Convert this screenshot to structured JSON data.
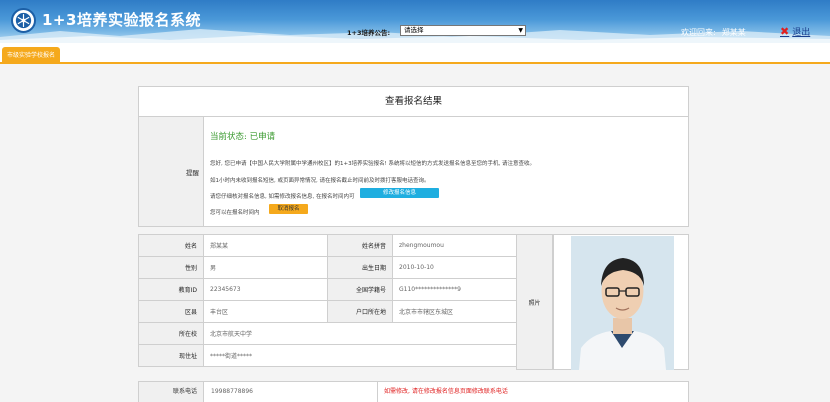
{
  "header": {
    "title": "1+3培养实验报名系统",
    "notice_label": "1+3培养公告:",
    "notice_select_value": "请选择",
    "welcome_label": "欢迎回来:",
    "user_name": "郑某某",
    "logout_label": "退出"
  },
  "tabs": [
    {
      "label": "市级实验学校报名"
    }
  ],
  "result": {
    "title": "查看报名结果",
    "remind_label": "提醒",
    "status": "当前状态: 已申请",
    "line1": "您好, 您已申请【中国人民大学附属中学通州校区】的1+3培养实验报名! 系统将以短信的方式发送报名信息至您的手机, 请注意查收。",
    "line2": "如1小时内未收到报名短信, 或页面异常情况, 请在报名截止时间前及时拨打客服电话查询。",
    "line3": "请您仔细核对报名信息, 如需修改报名信息, 在报名时间内可",
    "edit_button": "修改报名信息",
    "line4": "您可以在报名时间内",
    "cancel_button": "取消报名"
  },
  "info": {
    "name_label": "姓名",
    "name_value": "郑某某",
    "pinyin_label": "姓名拼音",
    "pinyin_value": "zhengmoumou",
    "gender_label": "性别",
    "gender_value": "男",
    "birth_label": "出生日期",
    "birth_value": "2010-10-10",
    "edu_id_label": "教育ID",
    "edu_id_value": "22345673",
    "student_no_label": "全国学籍号",
    "student_no_value": "G110**************9",
    "district_label": "区县",
    "district_value": "丰台区",
    "hukou_label": "户口所在地",
    "hukou_value": "北京市市辖区东城区",
    "school_label": "所在校",
    "school_value": "北京市航天中学",
    "address_label": "现住址",
    "address_value": "*****街道*****",
    "photo_label": "照片"
  },
  "contact": {
    "label": "联系电话",
    "value": "19988778896",
    "note": "如需修改, 请在修改报名信息页面修改联系电话"
  },
  "colors": {
    "header_blue": "#2f7cc6",
    "accent_orange": "#f5a91c",
    "status_green": "#3a9a2f",
    "button_blue": "#1faee0",
    "warning_red": "#e02020"
  }
}
